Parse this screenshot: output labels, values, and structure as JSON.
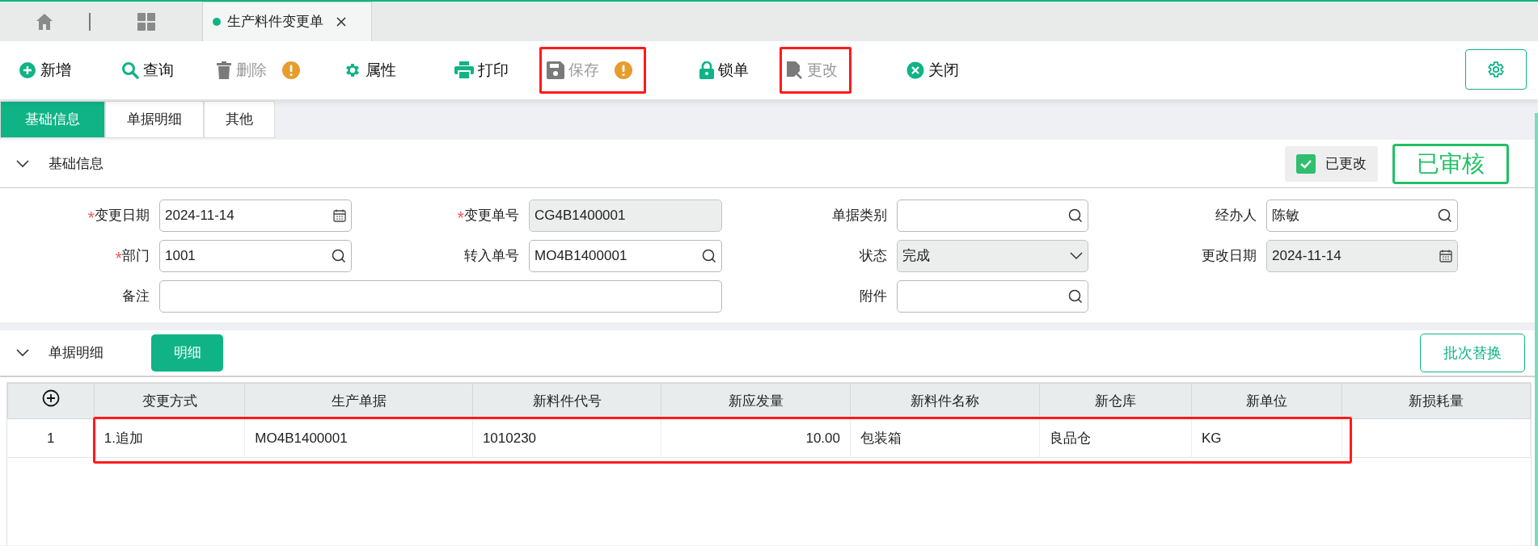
{
  "doc_tabs": [
    {
      "label": "生产料件变更单",
      "selected": true
    }
  ],
  "toolbar": [
    {
      "label": "新增",
      "disabled": false,
      "warning": false,
      "highlighted": false
    },
    {
      "label": "查询",
      "disabled": false,
      "warning": false,
      "highlighted": false
    },
    {
      "label": "删除",
      "disabled": true,
      "warning": true,
      "highlighted": false
    },
    {
      "label": "属性",
      "disabled": false,
      "warning": false,
      "highlighted": false
    },
    {
      "label": "打印",
      "disabled": false,
      "warning": false,
      "highlighted": false
    },
    {
      "label": "保存",
      "disabled": true,
      "warning": true,
      "highlighted": true
    },
    {
      "label": "锁单",
      "disabled": false,
      "warning": false,
      "highlighted": false
    },
    {
      "label": "更改",
      "disabled": true,
      "warning": false,
      "highlighted": true
    },
    {
      "label": "关闭",
      "disabled": false,
      "warning": false,
      "highlighted": false
    }
  ],
  "section_tabs": [
    {
      "label": "基础信息",
      "selected": true
    },
    {
      "label": "单据明细",
      "selected": false
    },
    {
      "label": "其他",
      "selected": false
    }
  ],
  "basic_info": {
    "title": "基础信息",
    "expanded": true,
    "changed": {
      "label": "已更改",
      "checked": true
    },
    "stamp": "已审核",
    "fields": [
      {
        "marker": "*",
        "label": "变更日期",
        "value": "2024-11-14",
        "kind": "date",
        "readonly": false
      },
      {
        "marker": "*",
        "label": "变更单号",
        "value": "CG4B1400001",
        "kind": "text",
        "readonly": true
      },
      {
        "label": "单据类别",
        "kind": "lookup",
        "readonly": false
      },
      {
        "label": "经办人",
        "value": "陈敏",
        "kind": "lookup",
        "readonly": false
      },
      {
        "marker": "*",
        "label": "部门",
        "value": "1001",
        "kind": "lookup",
        "readonly": false
      },
      {
        "label": "转入单号",
        "value": "MO4B1400001",
        "kind": "lookup",
        "readonly": false
      },
      {
        "label": "状态",
        "value": "完成",
        "kind": "select",
        "readonly": true
      },
      {
        "label": "更改日期",
        "value": "2024-11-14",
        "kind": "date",
        "readonly": true
      },
      {
        "label": "备注",
        "kind": "wide",
        "readonly": false
      },
      {
        "label": "附件",
        "kind": "lookup",
        "readonly": false
      }
    ]
  },
  "detail": {
    "title": "单据明细",
    "expanded": true,
    "button": "明细",
    "batch_button": "批次替换",
    "table": {
      "columns": [
        "变更方式",
        "生产单据",
        "新料件代号",
        "新应发量",
        "新料件名称",
        "新仓库",
        "新单位",
        "新损耗量"
      ],
      "rows": [
        {
          "index": "1",
          "highlighted": true,
          "cells": [
            "1.追加",
            "MO4B1400001",
            "1010230",
            "10.00",
            "包装箱",
            "良品仓",
            "KG",
            ""
          ]
        }
      ]
    }
  }
}
